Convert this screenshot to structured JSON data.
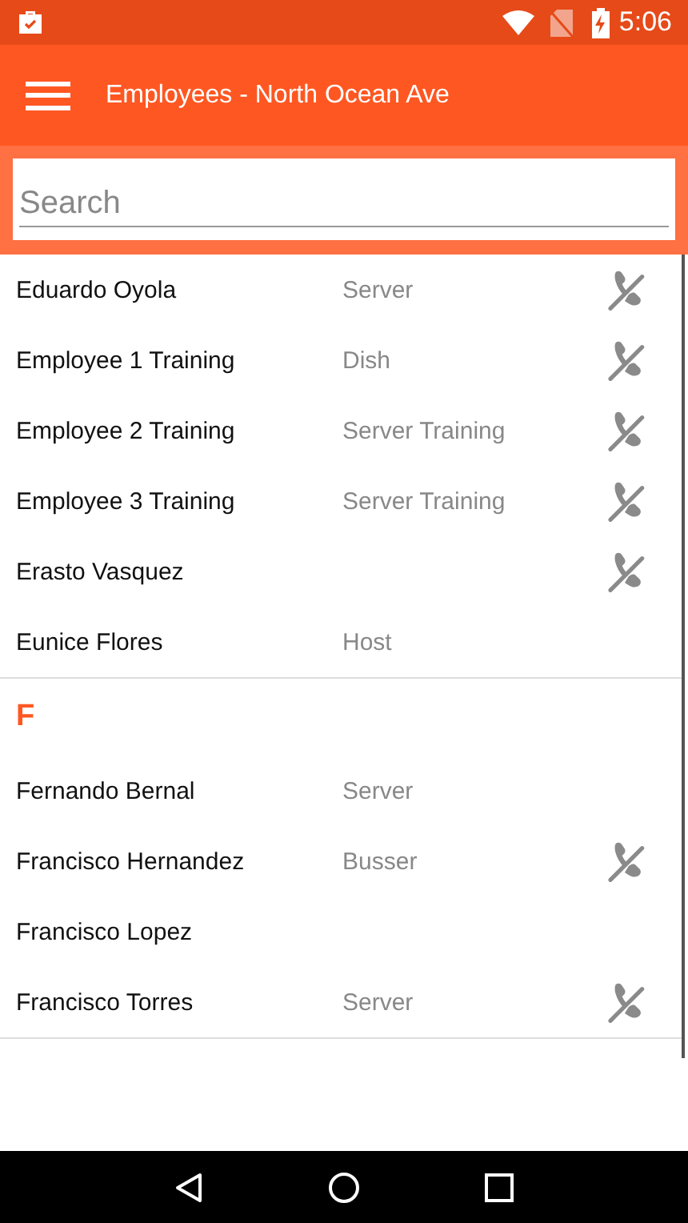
{
  "status_bar": {
    "time": "5:06"
  },
  "toolbar": {
    "title": "Employees - North Ocean Ave"
  },
  "search": {
    "placeholder": "Search"
  },
  "sections": [
    {
      "employees": [
        {
          "name": "Eduardo Oyola",
          "role": "Server",
          "phone": true
        },
        {
          "name": "Employee 1 Training",
          "role": "Dish",
          "phone": true
        },
        {
          "name": "Employee 2 Training",
          "role": "Server Training",
          "phone": true
        },
        {
          "name": "Employee 3 Training",
          "role": "Server Training",
          "phone": true
        },
        {
          "name": "Erasto Vasquez",
          "phone": true
        },
        {
          "name": "Eunice Flores",
          "role": "Host",
          "phone": false
        }
      ]
    },
    {
      "letter": "F",
      "employees": [
        {
          "name": "Fernando Bernal",
          "role": "Server",
          "phone": false
        },
        {
          "name": "Francisco Hernandez",
          "role": "Busser",
          "phone": true
        },
        {
          "name": "Francisco Lopez",
          "phone": false
        },
        {
          "name": "Francisco Torres",
          "role": "Server",
          "phone": true
        }
      ]
    }
  ]
}
